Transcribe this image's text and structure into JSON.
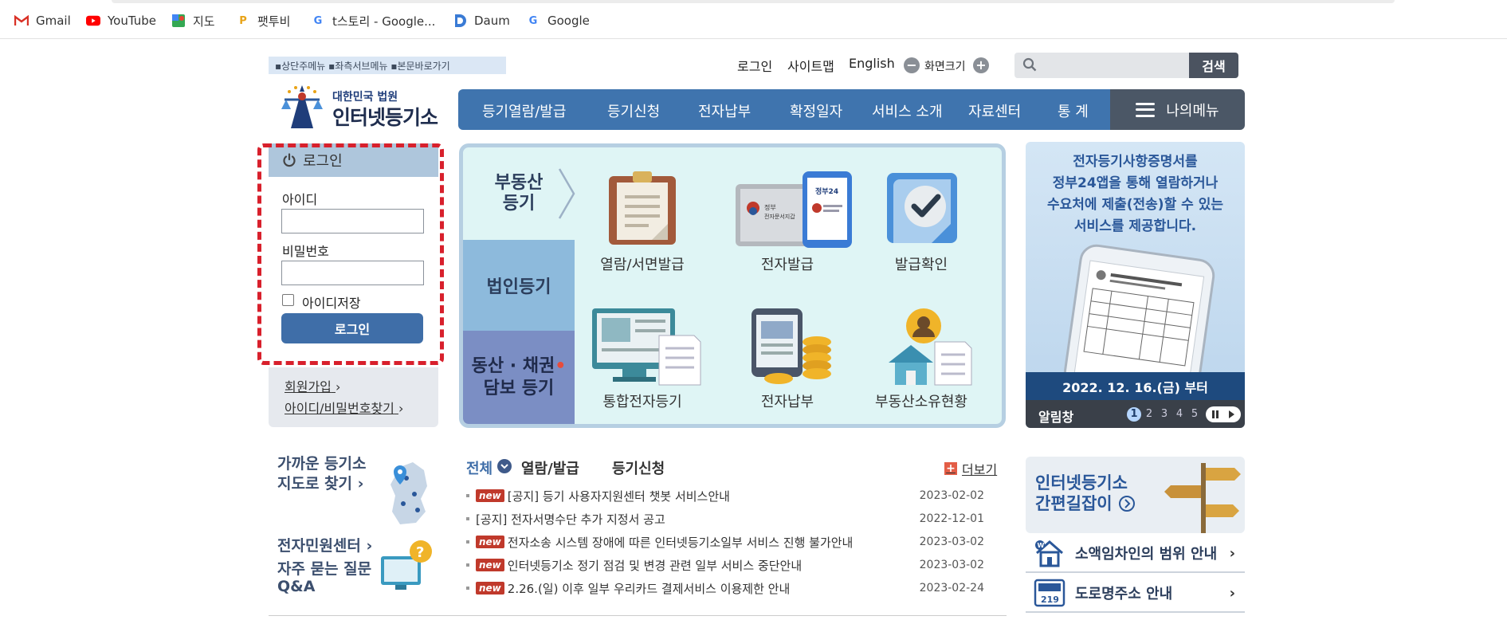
{
  "bookmarks": [
    {
      "label": "Gmail",
      "icon": "gmail-icon",
      "color": "#d93025"
    },
    {
      "label": "YouTube",
      "icon": "youtube-icon",
      "color": "#ff0000"
    },
    {
      "label": "지도",
      "icon": "maps-icon",
      "color": "#34a853"
    },
    {
      "label": "팻투비",
      "icon": "pattubi-icon",
      "color": "#e8a317"
    },
    {
      "label": "t스토리 - Google...",
      "icon": "google-icon",
      "color": "#4285f4"
    },
    {
      "label": "Daum",
      "icon": "daum-icon",
      "color": "#3a7bd5"
    },
    {
      "label": "Google",
      "icon": "google-icon",
      "color": "#4285f4"
    }
  ],
  "header": {
    "skip_links": "▪상단주메뉴 ▪좌측서브메뉴 ▪본문바로가기",
    "login": "로그인",
    "sitemap": "사이트맵",
    "english": "English",
    "zoom_label": "화면크기",
    "zoom_out": "−",
    "zoom_in": "+",
    "search_button": "검색"
  },
  "logo": {
    "sub": "대한민국 법원",
    "main": "인터넷등기소"
  },
  "gnb": {
    "items": [
      "등기열람/발급",
      "등기신청",
      "전자납부",
      "확정일자",
      "서비스 소개",
      "자료센터",
      "통 계"
    ],
    "my_menu": "나의메뉴"
  },
  "login_panel": {
    "title": "로그인",
    "id_label": "아이디",
    "pw_label": "비밀번호",
    "save_id": "아이디저장",
    "button": "로그인",
    "join": "회원가입",
    "join_arrow": "›",
    "find": "아이디/비밀번호찾기",
    "find_arrow": "›"
  },
  "services": {
    "tabs": {
      "real_estate_1": "부동산",
      "real_estate_2": "등기",
      "corp": "법인등기",
      "movable_1": "동산 · 채권",
      "movable_2": "담보 등기"
    },
    "items": [
      "열람/서면발급",
      "전자발급",
      "발급확인",
      "통합전자등기",
      "전자납부",
      "부동산소유현황"
    ],
    "phone_text_1": "정부24",
    "phone_text_2": "정부",
    "phone_text_3": "전자문서지갑"
  },
  "banner": {
    "line1": "전자등기사항증명서를",
    "line2": "정부24앱을 통해 열람하거나",
    "line3": "수요처에 제출(전송)할 수 있는",
    "line4": "서비스를 제공합니다.",
    "date": "2022. 12. 16.(금) 부터",
    "bar_title": "알림창",
    "pages": [
      "1",
      "2",
      "3",
      "4",
      "5"
    ],
    "active_page": 1
  },
  "side_links": {
    "near_1": "가까운 등기소",
    "near_2": "지도로 찾기 ›",
    "civil_center": "전자민원센터 ›",
    "faq_1": "자주 묻는 질문",
    "faq_2": "Q&A"
  },
  "notices": {
    "tabs": [
      "전체",
      "열람/발급",
      "등기신청"
    ],
    "more": "더보기",
    "new_badge": "new",
    "rows": [
      {
        "new": true,
        "title": "[공지] 등기 사용자지원센터 챗봇 서비스안내",
        "date": "2023-02-02"
      },
      {
        "new": false,
        "title": "[공지] 전자서명수단 추가 지정서 공고",
        "date": "2022-12-01"
      },
      {
        "new": true,
        "title": "전자소송 시스템 장애에 따른 인터넷등기소일부 서비스 진행 불가안내",
        "date": "2023-03-02"
      },
      {
        "new": true,
        "title": "인터넷등기소 정기 점검 및 변경 관련 일부 서비스 중단안내",
        "date": "2023-03-02"
      },
      {
        "new": true,
        "title": "2.26.(일) 이후 일부 우리카드 결제서비스 이용제한 안내",
        "date": "2023-02-24"
      }
    ]
  },
  "right_links": {
    "guide_1": "인터넷등기소",
    "guide_2": "간편길잡이",
    "lease": "소액임차인의 범위 안내",
    "road": "도로명주소 안내",
    "road_icon_number": "219",
    "arrow": "›"
  }
}
